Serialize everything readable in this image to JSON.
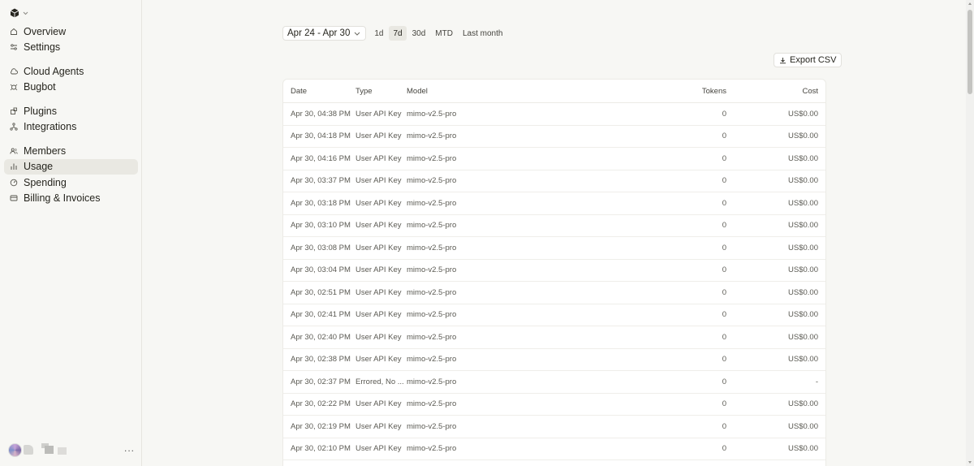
{
  "sidebar": {
    "groups": [
      [
        {
          "label": "Overview",
          "icon": "home-icon"
        },
        {
          "label": "Settings",
          "icon": "sliders-icon"
        }
      ],
      [
        {
          "label": "Cloud Agents",
          "icon": "cloud-icon"
        },
        {
          "label": "Bugbot",
          "icon": "bug-icon"
        }
      ],
      [
        {
          "label": "Plugins",
          "icon": "plugin-icon"
        },
        {
          "label": "Integrations",
          "icon": "integrations-icon"
        }
      ],
      [
        {
          "label": "Members",
          "icon": "members-icon"
        },
        {
          "label": "Usage",
          "icon": "bar-chart-icon",
          "active": true
        },
        {
          "label": "Spending",
          "icon": "gauge-icon"
        },
        {
          "label": "Billing & Invoices",
          "icon": "billing-icon"
        }
      ]
    ],
    "more_label": "..."
  },
  "filters": {
    "date_range": "Apr 24 - Apr 30",
    "ranges": [
      {
        "label": "1d"
      },
      {
        "label": "7d",
        "active": true
      },
      {
        "label": "30d"
      },
      {
        "label": "MTD"
      },
      {
        "label": "Last month"
      }
    ]
  },
  "export_label": "Export CSV",
  "table": {
    "columns": {
      "date": "Date",
      "type": "Type",
      "model": "Model",
      "tokens": "Tokens",
      "cost": "Cost"
    },
    "rows": [
      {
        "date": "Apr 30, 04:38 PM",
        "type": "User API Key",
        "model": "mimo-v2.5-pro",
        "tokens": "0",
        "cost": "US$0.00"
      },
      {
        "date": "Apr 30, 04:18 PM",
        "type": "User API Key",
        "model": "mimo-v2.5-pro",
        "tokens": "0",
        "cost": "US$0.00"
      },
      {
        "date": "Apr 30, 04:16 PM",
        "type": "User API Key",
        "model": "mimo-v2.5-pro",
        "tokens": "0",
        "cost": "US$0.00"
      },
      {
        "date": "Apr 30, 03:37 PM",
        "type": "User API Key",
        "model": "mimo-v2.5-pro",
        "tokens": "0",
        "cost": "US$0.00"
      },
      {
        "date": "Apr 30, 03:18 PM",
        "type": "User API Key",
        "model": "mimo-v2.5-pro",
        "tokens": "0",
        "cost": "US$0.00"
      },
      {
        "date": "Apr 30, 03:10 PM",
        "type": "User API Key",
        "model": "mimo-v2.5-pro",
        "tokens": "0",
        "cost": "US$0.00"
      },
      {
        "date": "Apr 30, 03:08 PM",
        "type": "User API Key",
        "model": "mimo-v2.5-pro",
        "tokens": "0",
        "cost": "US$0.00"
      },
      {
        "date": "Apr 30, 03:04 PM",
        "type": "User API Key",
        "model": "mimo-v2.5-pro",
        "tokens": "0",
        "cost": "US$0.00"
      },
      {
        "date": "Apr 30, 02:51 PM",
        "type": "User API Key",
        "model": "mimo-v2.5-pro",
        "tokens": "0",
        "cost": "US$0.00"
      },
      {
        "date": "Apr 30, 02:41 PM",
        "type": "User API Key",
        "model": "mimo-v2.5-pro",
        "tokens": "0",
        "cost": "US$0.00"
      },
      {
        "date": "Apr 30, 02:40 PM",
        "type": "User API Key",
        "model": "mimo-v2.5-pro",
        "tokens": "0",
        "cost": "US$0.00"
      },
      {
        "date": "Apr 30, 02:38 PM",
        "type": "User API Key",
        "model": "mimo-v2.5-pro",
        "tokens": "0",
        "cost": "US$0.00"
      },
      {
        "date": "Apr 30, 02:37 PM",
        "type": "Errored, No ...",
        "model": "mimo-v2.5-pro",
        "tokens": "0",
        "cost": "-"
      },
      {
        "date": "Apr 30, 02:22 PM",
        "type": "User API Key",
        "model": "mimo-v2.5-pro",
        "tokens": "0",
        "cost": "US$0.00"
      },
      {
        "date": "Apr 30, 02:19 PM",
        "type": "User API Key",
        "model": "mimo-v2.5-pro",
        "tokens": "0",
        "cost": "US$0.00"
      },
      {
        "date": "Apr 30, 02:10 PM",
        "type": "User API Key",
        "model": "mimo-v2.5-pro",
        "tokens": "0",
        "cost": "US$0.00"
      }
    ]
  }
}
